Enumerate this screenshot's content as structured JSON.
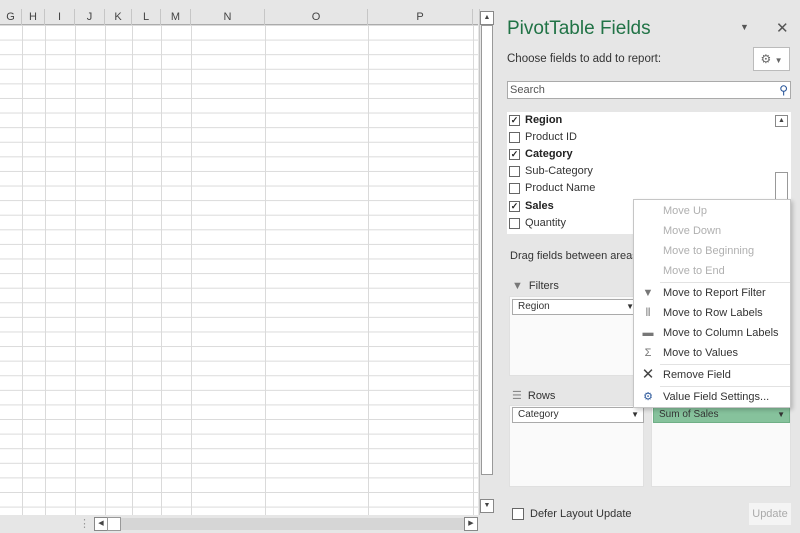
{
  "sheet": {
    "columns": [
      "G",
      "H",
      "I",
      "J",
      "K",
      "L",
      "M",
      "N",
      "O",
      "P"
    ]
  },
  "panel": {
    "title": "PivotTable Fields",
    "choose_label": "Choose fields to add to report:",
    "search_placeholder": "Search",
    "fields": [
      {
        "label": "Region",
        "checked": true
      },
      {
        "label": "Product ID",
        "checked": false
      },
      {
        "label": "Category",
        "checked": true
      },
      {
        "label": "Sub-Category",
        "checked": false
      },
      {
        "label": "Product Name",
        "checked": false
      },
      {
        "label": "Sales",
        "checked": true
      },
      {
        "label": "Quantity",
        "checked": false
      }
    ],
    "drag_label": "Drag fields between areas below:",
    "filters_label": "Filters",
    "filters_item": "Region",
    "rows_label": "Rows",
    "rows_item": "Category",
    "values_item": "Sum of Sales",
    "defer_label": "Defer Layout Update",
    "update_label": "Update"
  },
  "context_menu": {
    "items": [
      {
        "label": "Move Up",
        "enabled": false,
        "icon": ""
      },
      {
        "label": "Move Down",
        "enabled": false,
        "icon": ""
      },
      {
        "label": "Move to Beginning",
        "enabled": false,
        "icon": ""
      },
      {
        "label": "Move to End",
        "enabled": false,
        "icon": ""
      },
      {
        "label": "Move to Report Filter",
        "enabled": true,
        "icon": "filter-icon"
      },
      {
        "label": "Move to Row Labels",
        "enabled": true,
        "icon": "row-labels-icon"
      },
      {
        "label": "Move to Column Labels",
        "enabled": true,
        "icon": "column-labels-icon"
      },
      {
        "label": "Move to Values",
        "enabled": true,
        "icon": "sigma-icon"
      },
      {
        "label": "Remove Field",
        "enabled": true,
        "icon": "remove-icon"
      },
      {
        "label": "Value Field Settings...",
        "enabled": true,
        "icon": "field-settings-icon"
      }
    ]
  },
  "colors": {
    "accent": "#217346",
    "values_pill": "#86c29c"
  }
}
